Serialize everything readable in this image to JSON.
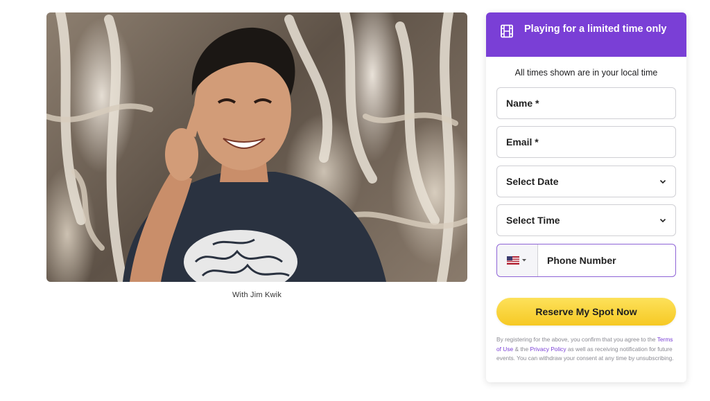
{
  "hero": {
    "caption": "With Jim Kwik"
  },
  "panel": {
    "banner_title": "Playing for a limited time only",
    "banner_icon": "film-icon",
    "timezone_note": "All times shown are in your local time",
    "name_placeholder": "Name *",
    "email_placeholder": "Email *",
    "date_select": "Select Date",
    "time_select": "Select Time",
    "phone_country_icon": "us-flag-icon",
    "phone_placeholder": "Phone Number",
    "cta_label": "Reserve My Spot Now",
    "legal": {
      "part1": "By registering for the above, you confirm that you agree to the ",
      "terms_link": "Terms of Use",
      "part2": " & the ",
      "privacy_link": "Privacy Policy",
      "part3": " as well as receiving notification for future events. You can withdraw your consent at any time by unsubscribing."
    }
  },
  "colors": {
    "accent": "#7a3fd6",
    "cta": "#f8d332"
  }
}
